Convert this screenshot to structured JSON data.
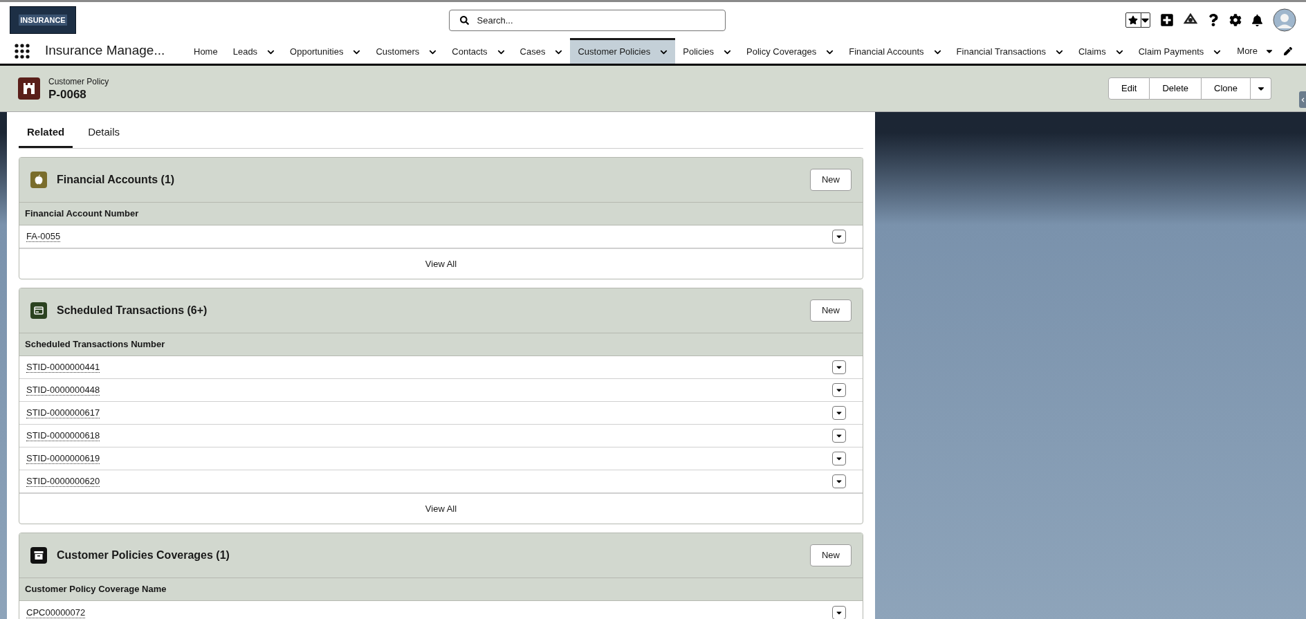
{
  "app_logo": {
    "text": "INSURANCE"
  },
  "search": {
    "placeholder": "Search..."
  },
  "app_name": "Insurance Manage...",
  "nav_items": [
    {
      "label": "Home",
      "selected": false,
      "has_menu": false
    },
    {
      "label": "Leads",
      "selected": false,
      "has_menu": true
    },
    {
      "label": "Opportunities",
      "selected": false,
      "has_menu": true
    },
    {
      "label": "Customers",
      "selected": false,
      "has_menu": true
    },
    {
      "label": "Contacts",
      "selected": false,
      "has_menu": true
    },
    {
      "label": "Cases",
      "selected": false,
      "has_menu": true
    },
    {
      "label": "Customer Policies",
      "selected": true,
      "has_menu": true
    },
    {
      "label": "Policies",
      "selected": false,
      "has_menu": true
    },
    {
      "label": "Policy Coverages",
      "selected": false,
      "has_menu": true
    },
    {
      "label": "Financial Accounts",
      "selected": false,
      "has_menu": true
    },
    {
      "label": "Financial Transactions",
      "selected": false,
      "has_menu": true
    },
    {
      "label": "Claims",
      "selected": false,
      "has_menu": true
    },
    {
      "label": "Claim Payments",
      "selected": false,
      "has_menu": true
    }
  ],
  "nav_more": {
    "label": "More"
  },
  "record": {
    "type_label": "Customer Policy",
    "name": "P-0068",
    "actions": [
      "Edit",
      "Delete",
      "Clone"
    ]
  },
  "tabs": [
    {
      "label": "Related",
      "selected": true
    },
    {
      "label": "Details",
      "selected": false
    }
  ],
  "related_lists": [
    {
      "title": "Financial Accounts (1)",
      "kind": "apple",
      "color": "#7a6d2c",
      "button": "New",
      "column": "Financial Account Number",
      "rows": [
        "FA-0055"
      ],
      "footer": "View All"
    },
    {
      "title": "Scheduled Transactions (6+)",
      "kind": "card",
      "color": "#2b4220",
      "button": "New",
      "column": "Scheduled Transactions Number",
      "rows": [
        "STID-0000000441",
        "STID-0000000448",
        "STID-0000000617",
        "STID-0000000618",
        "STID-0000000619",
        "STID-0000000620"
      ],
      "footer": "View All"
    },
    {
      "title": "Customer Policies Coverages (1)",
      "kind": "archive",
      "color": "#111111",
      "button": "New",
      "column": "Customer Policy Coverage Name",
      "rows": [
        "CPC00000072"
      ]
    }
  ]
}
